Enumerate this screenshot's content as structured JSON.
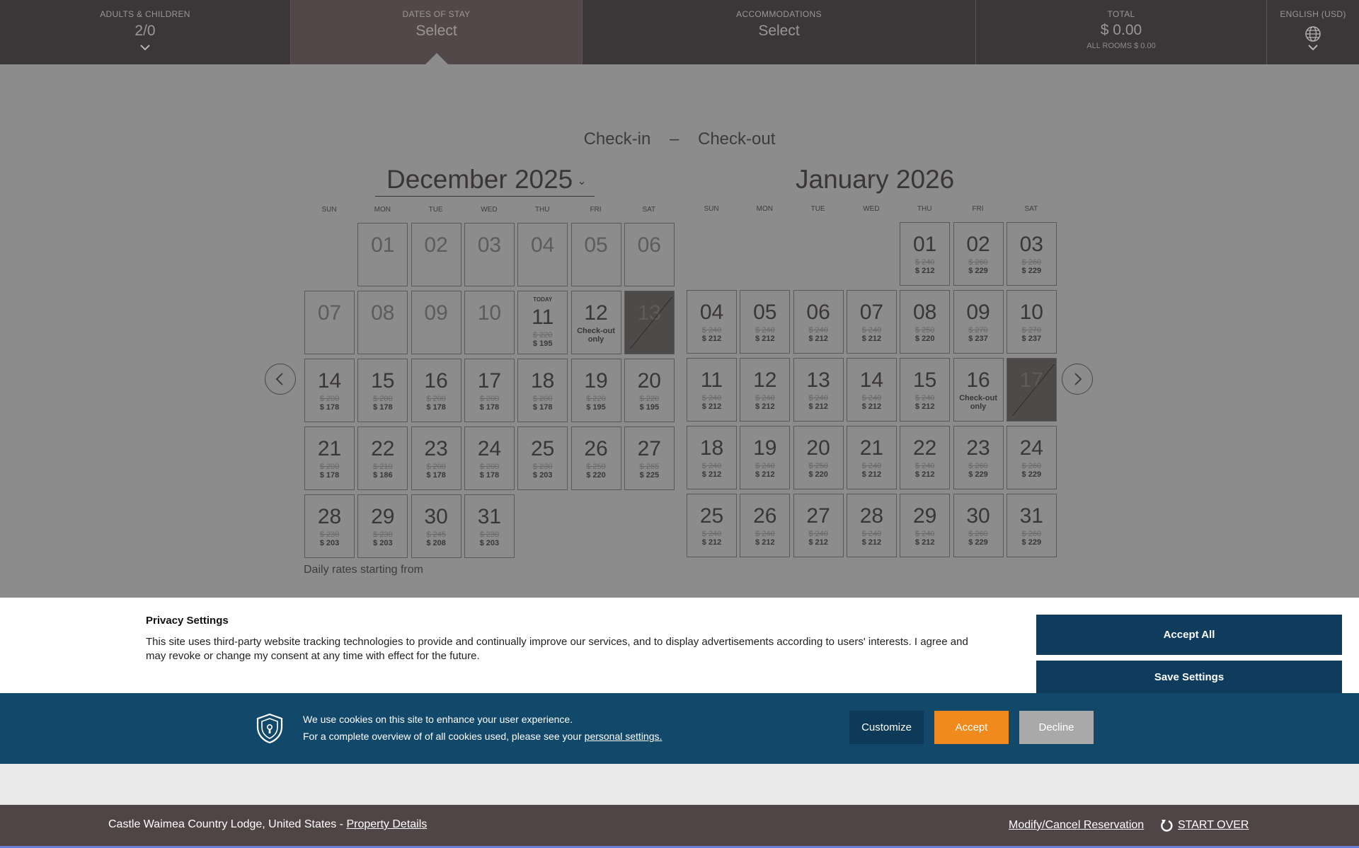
{
  "topbar": {
    "guests": {
      "label": "ADULTS & CHILDREN",
      "value": "2/0"
    },
    "dates": {
      "label": "DATES OF STAY",
      "value": "Select"
    },
    "accommodations": {
      "label": "ACCOMMODATIONS",
      "value": "Select"
    },
    "total": {
      "label": "TOTAL",
      "value": "$ 0.00",
      "sub": "ALL ROOMS $ 0.00"
    },
    "language": {
      "label": "ENGLISH (USD)",
      "icon": "globe-icon"
    }
  },
  "range": {
    "checkin": "Check-in",
    "sep": "–",
    "checkout": "Check-out"
  },
  "weekdays": [
    "SUN",
    "MON",
    "TUE",
    "WED",
    "THU",
    "FRI",
    "SAT"
  ],
  "calendar": {
    "december": {
      "title": "December 2025",
      "weeks": [
        [
          null,
          {
            "d": "01",
            "state": "past"
          },
          {
            "d": "02",
            "state": "past"
          },
          {
            "d": "03",
            "state": "past"
          },
          {
            "d": "04",
            "state": "past"
          },
          {
            "d": "05",
            "state": "past"
          },
          {
            "d": "06",
            "state": "past"
          }
        ],
        [
          {
            "d": "07",
            "state": "past"
          },
          {
            "d": "08",
            "state": "past"
          },
          {
            "d": "09",
            "state": "past"
          },
          {
            "d": "10",
            "state": "past"
          },
          {
            "d": "11",
            "today": "TODAY",
            "old": "$ 220",
            "new": "$ 195"
          },
          {
            "d": "12",
            "note": "Check-out only"
          },
          {
            "d": "13",
            "state": "blocked"
          }
        ],
        [
          {
            "d": "14",
            "old": "$ 200",
            "new": "$ 178"
          },
          {
            "d": "15",
            "old": "$ 200",
            "new": "$ 178"
          },
          {
            "d": "16",
            "old": "$ 200",
            "new": "$ 178"
          },
          {
            "d": "17",
            "old": "$ 200",
            "new": "$ 178"
          },
          {
            "d": "18",
            "old": "$ 200",
            "new": "$ 178"
          },
          {
            "d": "19",
            "old": "$ 220",
            "new": "$ 195"
          },
          {
            "d": "20",
            "old": "$ 220",
            "new": "$ 195"
          }
        ],
        [
          {
            "d": "21",
            "old": "$ 200",
            "new": "$ 178"
          },
          {
            "d": "22",
            "old": "$ 210",
            "new": "$ 186"
          },
          {
            "d": "23",
            "old": "$ 200",
            "new": "$ 178"
          },
          {
            "d": "24",
            "old": "$ 200",
            "new": "$ 178"
          },
          {
            "d": "25",
            "old": "$ 230",
            "new": "$ 203"
          },
          {
            "d": "26",
            "old": "$ 250",
            "new": "$ 220"
          },
          {
            "d": "27",
            "old": "$ 265",
            "new": "$ 225"
          }
        ],
        [
          {
            "d": "28",
            "old": "$ 230",
            "new": "$ 203"
          },
          {
            "d": "29",
            "old": "$ 230",
            "new": "$ 203"
          },
          {
            "d": "30",
            "old": "$ 245",
            "new": "$ 208"
          },
          {
            "d": "31",
            "old": "$ 230",
            "new": "$ 203"
          },
          null,
          null,
          null
        ]
      ]
    },
    "january": {
      "title": "January 2026",
      "weeks": [
        [
          null,
          null,
          null,
          null,
          {
            "d": "01",
            "old": "$ 240",
            "new": "$ 212"
          },
          {
            "d": "02",
            "old": "$ 260",
            "new": "$ 229"
          },
          {
            "d": "03",
            "old": "$ 260",
            "new": "$ 229"
          }
        ],
        [
          {
            "d": "04",
            "old": "$ 240",
            "new": "$ 212"
          },
          {
            "d": "05",
            "old": "$ 240",
            "new": "$ 212"
          },
          {
            "d": "06",
            "old": "$ 240",
            "new": "$ 212"
          },
          {
            "d": "07",
            "old": "$ 240",
            "new": "$ 212"
          },
          {
            "d": "08",
            "old": "$ 250",
            "new": "$ 220"
          },
          {
            "d": "09",
            "old": "$ 270",
            "new": "$ 237"
          },
          {
            "d": "10",
            "old": "$ 270",
            "new": "$ 237"
          }
        ],
        [
          {
            "d": "11",
            "old": "$ 240",
            "new": "$ 212"
          },
          {
            "d": "12",
            "old": "$ 240",
            "new": "$ 212"
          },
          {
            "d": "13",
            "old": "$ 240",
            "new": "$ 212"
          },
          {
            "d": "14",
            "old": "$ 240",
            "new": "$ 212"
          },
          {
            "d": "15",
            "old": "$ 240",
            "new": "$ 212"
          },
          {
            "d": "16",
            "note": "Check-out only"
          },
          {
            "d": "17",
            "state": "blocked"
          }
        ],
        [
          {
            "d": "18",
            "old": "$ 240",
            "new": "$ 212"
          },
          {
            "d": "19",
            "old": "$ 240",
            "new": "$ 212"
          },
          {
            "d": "20",
            "old": "$ 250",
            "new": "$ 220"
          },
          {
            "d": "21",
            "old": "$ 240",
            "new": "$ 212"
          },
          {
            "d": "22",
            "old": "$ 240",
            "new": "$ 212"
          },
          {
            "d": "23",
            "old": "$ 260",
            "new": "$ 229"
          },
          {
            "d": "24",
            "old": "$ 260",
            "new": "$ 229"
          }
        ],
        [
          {
            "d": "25",
            "old": "$ 240",
            "new": "$ 212"
          },
          {
            "d": "26",
            "old": "$ 240",
            "new": "$ 212"
          },
          {
            "d": "27",
            "old": "$ 240",
            "new": "$ 212"
          },
          {
            "d": "28",
            "old": "$ 240",
            "new": "$ 212"
          },
          {
            "d": "29",
            "old": "$ 240",
            "new": "$ 212"
          },
          {
            "d": "30",
            "old": "$ 260",
            "new": "$ 229"
          },
          {
            "d": "31",
            "old": "$ 260",
            "new": "$ 229"
          }
        ]
      ]
    }
  },
  "footnote": "Daily rates starting from",
  "privacy": {
    "title": "Privacy Settings",
    "text": "This site uses third-party website tracking technologies to provide and continually improve our services, and to display advertisements according to users' interests. I agree and may revoke or change my consent at any time with effect for the future.",
    "accept_all": "Accept All",
    "save_settings": "Save Settings"
  },
  "cookie": {
    "line1": "We use cookies on this site to enhance your user experience.",
    "line2_prefix": "For a complete overview of of all cookies used, please see your ",
    "line2_link": "personal settings.",
    "customize": "Customize",
    "accept": "Accept",
    "decline": "Decline"
  },
  "footer": {
    "property": "Castle Waimea Country Lodge, United States - ",
    "property_link": "Property Details",
    "modify": "Modify/Cancel Reservation",
    "start_over": "START OVER"
  }
}
